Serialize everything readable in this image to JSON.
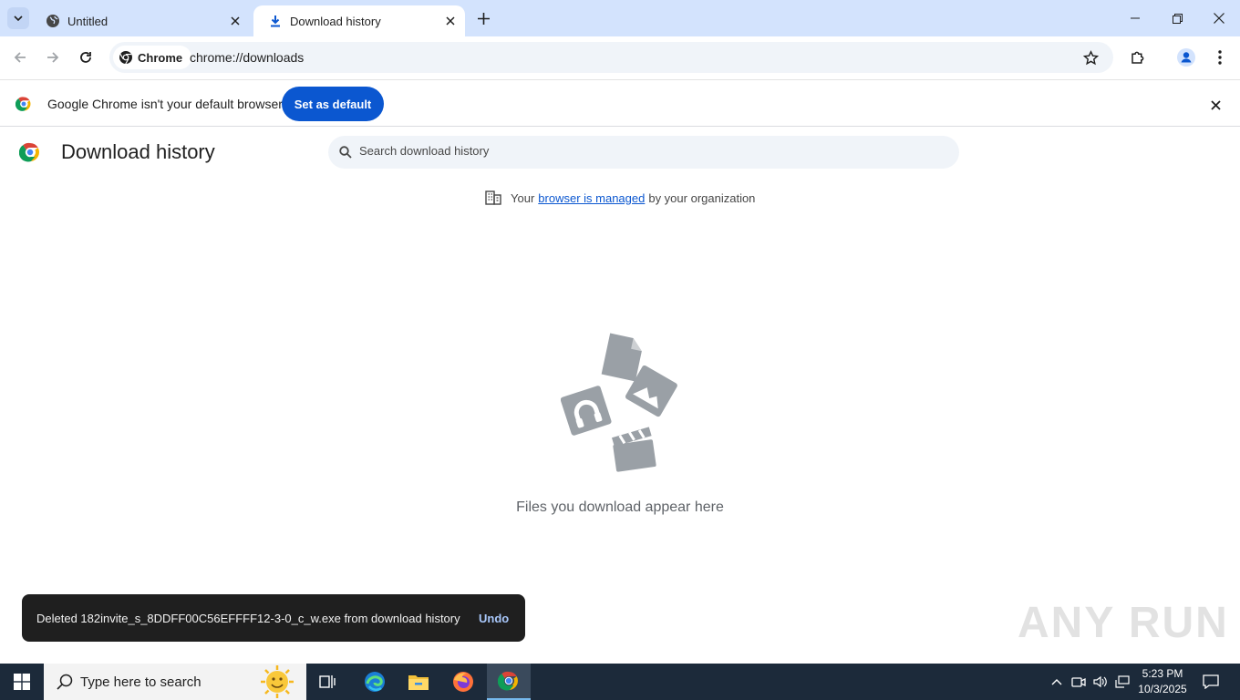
{
  "tabs": [
    {
      "title": "Untitled",
      "icon": "globe-icon",
      "active": false
    },
    {
      "title": "Download history",
      "icon": "download-icon",
      "active": true
    }
  ],
  "toolbar": {
    "chip_label": "Chrome",
    "url": "chrome://downloads"
  },
  "infobar": {
    "message": "Google Chrome isn't your default browser",
    "button_label": "Set as default"
  },
  "page": {
    "title": "Download history",
    "search_placeholder": "Search download history",
    "managed_prefix": "Your",
    "managed_link": "browser is managed",
    "managed_suffix": "by your organization",
    "empty_message": "Files you download appear here"
  },
  "toast": {
    "message": "Deleted 182invite_s_8DDFF00C56EFFFF12-3-0_c_w.exe from download history",
    "action": "Undo"
  },
  "watermark": "ANY RUN",
  "taskbar": {
    "search_placeholder": "Type here to search",
    "time": "5:23 PM",
    "date": "10/3/2025"
  },
  "colors": {
    "tabstrip_bg": "#d3e3fd",
    "accent": "#0b57d0",
    "taskbar_bg": "#1c2a3a"
  }
}
